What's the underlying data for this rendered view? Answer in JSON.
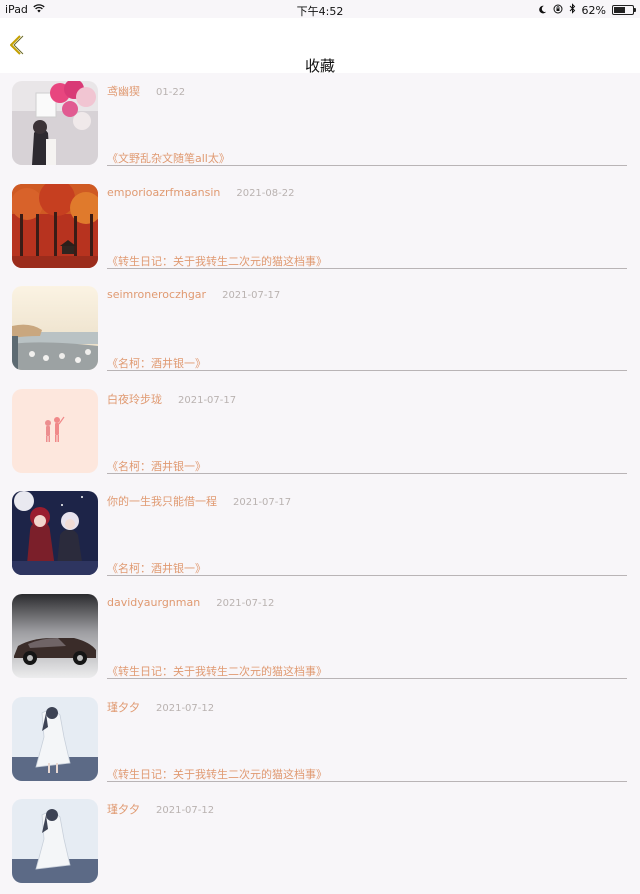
{
  "status_bar": {
    "device": "iPad",
    "time": "下午4:52",
    "battery": "62%",
    "battery_level": 0.62
  },
  "nav": {
    "title": "收藏",
    "back_icon": "chevron-left-icon",
    "accent_color": "#c4a000"
  },
  "colors": {
    "name_text": "#e09a72",
    "date_text": "#b9b2b0",
    "divider": "#b9b4b6",
    "page_bg": "#f8f6f9"
  },
  "items": [
    {
      "name": "鸢幽猰",
      "date": "01-22",
      "title": "《文野乱杂文随笔all太》",
      "thumb": "girl-with-balloons"
    },
    {
      "name": "emporioazrfmaansin",
      "date": "2021-08-22",
      "title": "《转生日记：关于我转生二次元的猫这档事》",
      "thumb": "autumn-forest"
    },
    {
      "name": "seimroneroczhgar",
      "date": "2021-07-17",
      "title": "《名柯：酒井银一》",
      "thumb": "seaside-rocks"
    },
    {
      "name": "白夜玲步珑",
      "date": "2021-07-17",
      "title": "《名柯：酒井银一》",
      "thumb": "pink-couple-illustration"
    },
    {
      "name": "你的一生我只能借一程",
      "date": "2021-07-17",
      "title": "《名柯：酒井银一》",
      "thumb": "anime-characters"
    },
    {
      "name": "davidyaurgnman",
      "date": "2021-07-12",
      "title": "《转生日记：关于我转生二次元的猫这档事》",
      "thumb": "luxury-car"
    },
    {
      "name": "瑾夕夕",
      "date": "2021-07-12",
      "title": "《转生日记：关于我转生二次元的猫这档事》",
      "thumb": "anime-girl-white-dress"
    },
    {
      "name": "瑾夕夕",
      "date": "2021-07-12",
      "title": "",
      "thumb": "anime-girl-white-dress"
    }
  ]
}
